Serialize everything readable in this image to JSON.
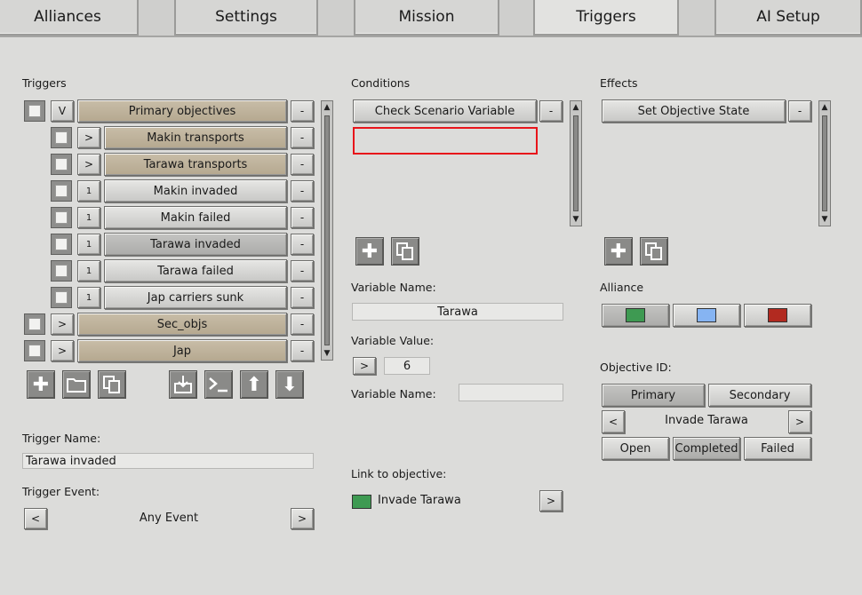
{
  "tabs": [
    "Alliances",
    "Settings",
    "Mission",
    "Triggers",
    "AI Setup"
  ],
  "triggers": {
    "heading": "Triggers",
    "rows": [
      {
        "expander": "V",
        "label": "Primary objectives",
        "minus": "-"
      },
      {
        "expander": ">",
        "label": "Makin transports",
        "minus": "-"
      },
      {
        "expander": ">",
        "label": "Tarawa transports",
        "minus": "-"
      },
      {
        "expander": "1",
        "label": "Makin invaded",
        "minus": "-"
      },
      {
        "expander": "1",
        "label": "Makin failed",
        "minus": "-"
      },
      {
        "expander": "1",
        "label": "Tarawa invaded",
        "minus": "-"
      },
      {
        "expander": "1",
        "label": "Tarawa failed",
        "minus": "-"
      },
      {
        "expander": "1",
        "label": "Jap carriers sunk",
        "minus": "-"
      },
      {
        "expander": ">",
        "label": "Sec_objs",
        "minus": "-"
      },
      {
        "expander": ">",
        "label": "Jap",
        "minus": "-"
      }
    ],
    "trigger_name_label": "Trigger Name:",
    "trigger_name_value": "Tarawa invaded",
    "trigger_event_label": "Trigger Event:",
    "trigger_event_value": "Any Event",
    "prev": "<",
    "next": ">"
  },
  "conditions": {
    "heading": "Conditions",
    "item": "Check Scenario Variable",
    "minus": "-",
    "variable_name_label": "Variable Name:",
    "variable_name_value": "Tarawa",
    "variable_value_label": "Variable Value:",
    "variable_value_op": ">",
    "variable_value": "6",
    "variable_name2_label": "Variable Name:",
    "variable_name2_value": "",
    "link_label": "Link to objective:",
    "link_value": "Invade Tarawa",
    "link_btn": ">"
  },
  "effects": {
    "heading": "Effects",
    "item": "Set Objective State",
    "minus": "-",
    "alliance_label": "Alliance",
    "alliance_colors": [
      "#3e9a52",
      "#86b4f2",
      "#b22a20"
    ],
    "objective_id_label": "Objective ID:",
    "primary": "Primary",
    "secondary": "Secondary",
    "prev": "<",
    "objective": "Invade Tarawa",
    "next": ">",
    "open": "Open",
    "completed": "Completed",
    "failed": "Failed"
  },
  "link_color": "#3e9a52"
}
